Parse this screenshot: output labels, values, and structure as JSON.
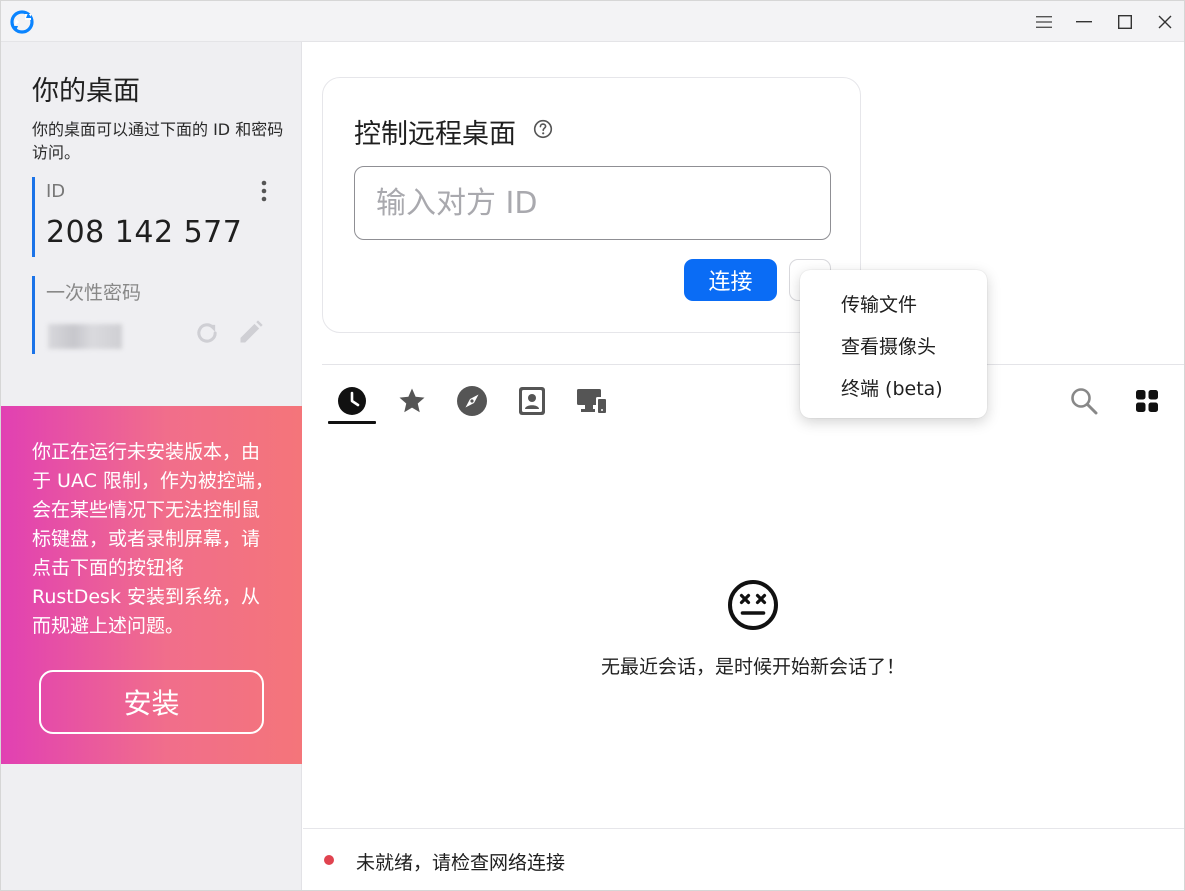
{
  "titlebar": {
    "logo_icon": "rustdesk-logo-icon",
    "menu_icon": "hamburger-icon",
    "minimize_icon": "minimize-icon",
    "maximize_icon": "maximize-icon",
    "close_icon": "close-icon"
  },
  "left_panel": {
    "title": "你的桌面",
    "description": "你的桌面可以通过下面的 ID 和密码访问。",
    "id_label": "ID",
    "id_value": "208 142 577",
    "password_label": "一次性密码",
    "install_notice": "你正在运行未安装版本，由于 UAC 限制，作为被控端，会在某些情况下无法控制鼠标键盘，或者录制屏幕，请点击下面的按钮将 RustDesk 安装到系统，从而规避上述问题。",
    "install_button": "安装",
    "colors": {
      "accent": "#1b73e8",
      "gradient_start": "#e140b3",
      "gradient_end": "#f4757a"
    }
  },
  "connect": {
    "title": "控制远程桌面",
    "input_placeholder": "输入对方 ID",
    "input_value": "",
    "connect_button": "连接",
    "button_color": "#0a6cf5"
  },
  "dropdown": {
    "items": [
      "传输文件",
      "查看摄像头",
      "终端 (beta)"
    ]
  },
  "tabs": [
    {
      "icon": "recent-sessions-icon",
      "active": true
    },
    {
      "icon": "favorites-star-icon",
      "active": false
    },
    {
      "icon": "discovered-compass-icon",
      "active": false
    },
    {
      "icon": "address-book-icon",
      "active": false
    },
    {
      "icon": "group-devices-icon",
      "active": false
    }
  ],
  "empty_state": {
    "icon": "dizzy-face-icon",
    "message": "无最近会话，是时候开始新会话了！"
  },
  "status": {
    "text": "未就绪，请检查网络连接",
    "dot_color": "#e0434f"
  }
}
